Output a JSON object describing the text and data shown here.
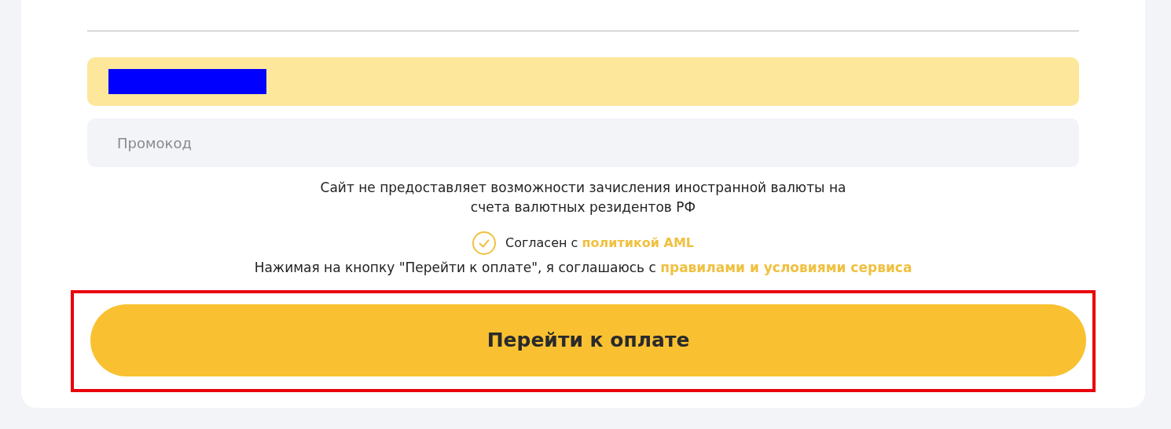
{
  "promo_field": {
    "placeholder": "Промокод"
  },
  "notice": "Сайт не предоставляет возможности зачисления иностранной валюты на счета валютных резидентов РФ",
  "aml_agreement": {
    "checked": true,
    "text": "Согласен с ",
    "link": "политикой AML"
  },
  "terms": {
    "text": "Нажимая на кнопку \"Перейти к оплате\", я соглашаюсь с ",
    "link": "правилами и условиями сервиса"
  },
  "pay_button": {
    "label": "Перейти к оплате",
    "highlighted": true
  }
}
